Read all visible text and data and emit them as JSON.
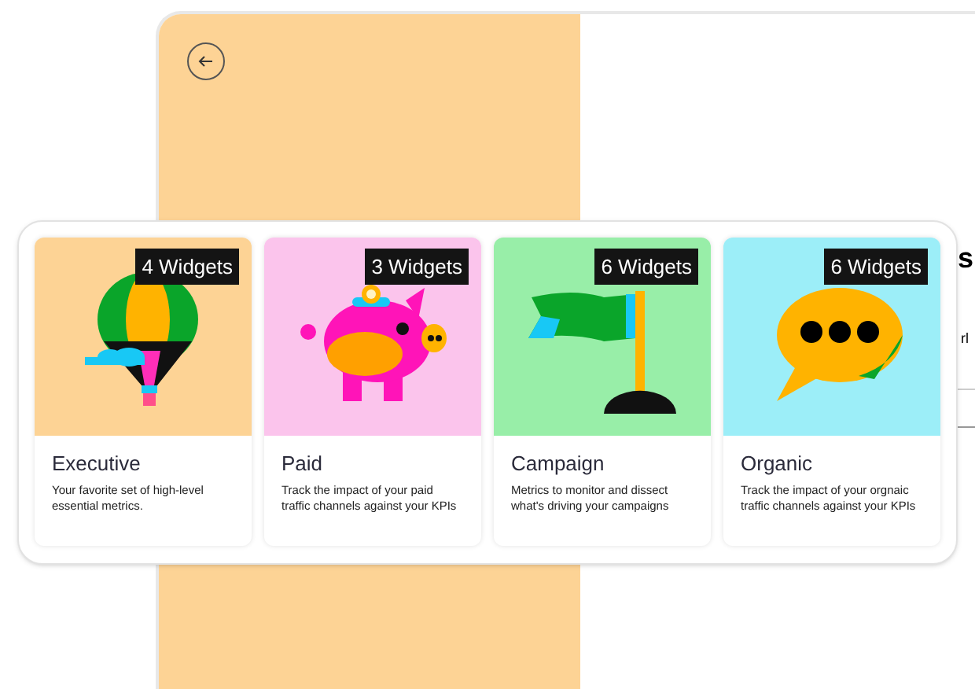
{
  "background_window": {
    "heading_fragment": "s",
    "text_fragment": "rl"
  },
  "templates": [
    {
      "kind": "balloon",
      "color": "#fdd395",
      "badge": "4 Widgets",
      "title": "Executive",
      "description": "Your favorite set of high-level essential metrics."
    },
    {
      "kind": "pig",
      "color": "#fbc4ec",
      "badge": "3 Widgets",
      "title": "Paid",
      "description": "Track the impact of your paid traffic channels against your KPIs"
    },
    {
      "kind": "flag",
      "color": "#98eea8",
      "badge": "6 Widgets",
      "title": "Campaign",
      "description": "Metrics to monitor and dissect what's driving your campaigns"
    },
    {
      "kind": "chat",
      "color": "#9ceef8",
      "badge": "6 Widgets",
      "title": "Organic",
      "description": "Track the impact of your orgnaic traffic channels against your KPIs"
    }
  ]
}
